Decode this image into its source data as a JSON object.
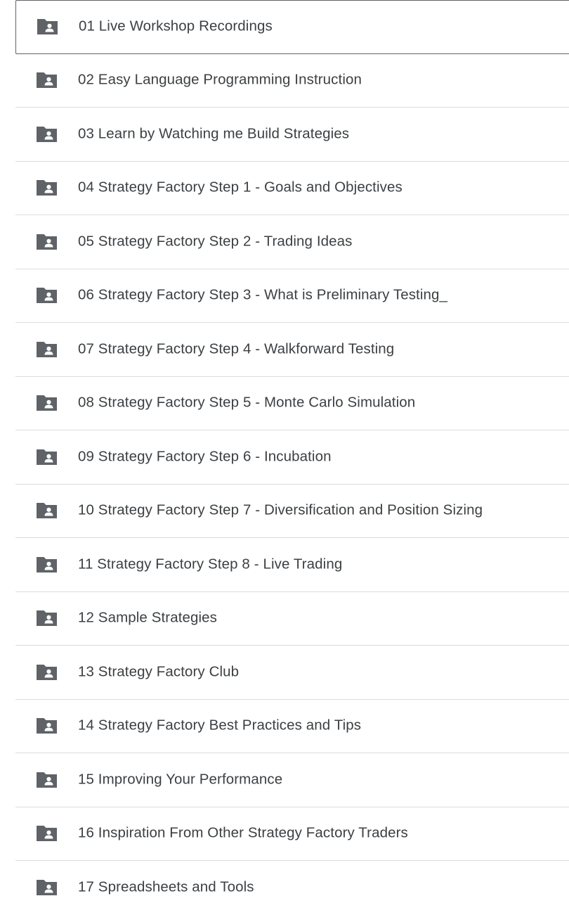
{
  "folders": [
    {
      "name": "01 Live Workshop Recordings",
      "selected": true
    },
    {
      "name": "02 Easy Language Programming Instruction"
    },
    {
      "name": "03 Learn by Watching me Build Strategies"
    },
    {
      "name": "04 Strategy Factory Step 1 - Goals and Objectives"
    },
    {
      "name": "05 Strategy Factory Step 2 - Trading Ideas"
    },
    {
      "name": "06 Strategy Factory Step 3 - What is Preliminary Testing_"
    },
    {
      "name": "07 Strategy Factory Step 4 - Walkforward Testing"
    },
    {
      "name": "08 Strategy Factory Step 5 - Monte Carlo Simulation"
    },
    {
      "name": "09 Strategy Factory Step 6 - Incubation"
    },
    {
      "name": "10 Strategy Factory Step 7 - Diversification and Position Sizing"
    },
    {
      "name": "11 Strategy Factory Step 8 - Live Trading"
    },
    {
      "name": "12 Sample Strategies"
    },
    {
      "name": "13 Strategy Factory Club"
    },
    {
      "name": "14 Strategy Factory Best Practices and Tips"
    },
    {
      "name": "15 Improving Your Performance"
    },
    {
      "name": "16 Inspiration From Other Strategy Factory Traders"
    },
    {
      "name": "17 Spreadsheets and Tools"
    }
  ],
  "icon": "shared-folder-icon",
  "colors": {
    "icon": "#5f6368",
    "text": "#3c4043",
    "divider": "#dadce0",
    "selected_border": "#5f6368"
  }
}
